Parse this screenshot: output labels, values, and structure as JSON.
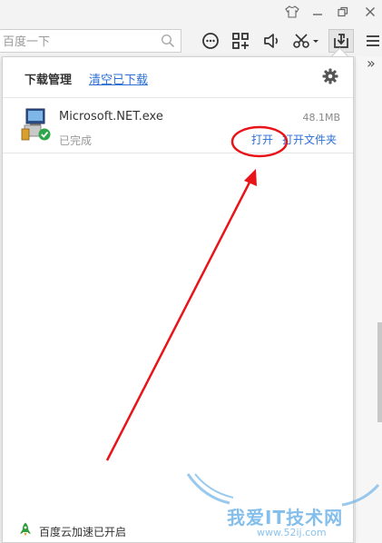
{
  "titlebar": {
    "icons": [
      "shirt-icon",
      "minimize-icon",
      "restore-icon",
      "close-icon"
    ]
  },
  "toolbar": {
    "search_placeholder": "百度一下",
    "icons": [
      "search-icon",
      "chat-icon",
      "apps-icon",
      "sound-icon",
      "scissors-icon",
      "download-icon",
      "menu-icon"
    ]
  },
  "right_strip": {
    "expand_label": "»"
  },
  "download_panel": {
    "title": "下载管理",
    "clear_label": "清空已下载",
    "settings_icon": "gear-icon",
    "items": [
      {
        "file_name": "Microsoft.NET.exe",
        "size": "48.1MB",
        "status": "已完成",
        "open_label": "打开",
        "open_folder_label": "打开文件夹",
        "icon": "installer-file-icon"
      }
    ],
    "accelerator_text": "百度云加速已开启",
    "accelerator_icon": "rocket-icon"
  },
  "watermark": {
    "text": "我爱IT技术网",
    "url": "www.52ij.com"
  },
  "colors": {
    "link": "#2b6fd6",
    "annotation": "#e8141a",
    "accelerator": "#2e9e3a",
    "watermark": "#6fb4e8"
  }
}
